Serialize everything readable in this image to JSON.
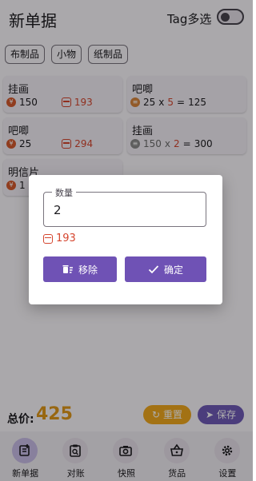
{
  "header": {
    "title": "新单据",
    "tag_multi_label": "Tag多选"
  },
  "chips": [
    {
      "label": "布制品"
    },
    {
      "label": "小物"
    },
    {
      "label": "纸制品"
    }
  ],
  "cards": {
    "c1": {
      "name": "挂画",
      "price": "150",
      "stock": "193"
    },
    "c2": {
      "name": "吧唧",
      "line_qty": "25",
      "op_mul": "x",
      "line_count": "5",
      "op_eq": "=",
      "line_total": "125"
    },
    "c3": {
      "name": "吧唧",
      "price": "25",
      "stock": "294"
    },
    "c4": {
      "name": "挂画",
      "line_qty": "150",
      "op_mul": "x",
      "line_count": "2",
      "op_eq": "=",
      "line_total": "300"
    },
    "c5": {
      "name": "明信片",
      "price": "1"
    }
  },
  "footer": {
    "total_label": "总价:",
    "total_value": "425",
    "reset_label": "重置",
    "save_label": "保存"
  },
  "nav": [
    {
      "label": "新单据"
    },
    {
      "label": "对账"
    },
    {
      "label": "快照"
    },
    {
      "label": "货品"
    },
    {
      "label": "设置"
    }
  ],
  "dialog": {
    "field_label": "数量",
    "field_value": "2",
    "stock": "193",
    "remove_label": "移除",
    "confirm_label": "确定"
  },
  "colors": {
    "accent_purple": "#6f52b5",
    "total_orange": "#e0991a",
    "stock_red": "#d5462f"
  }
}
